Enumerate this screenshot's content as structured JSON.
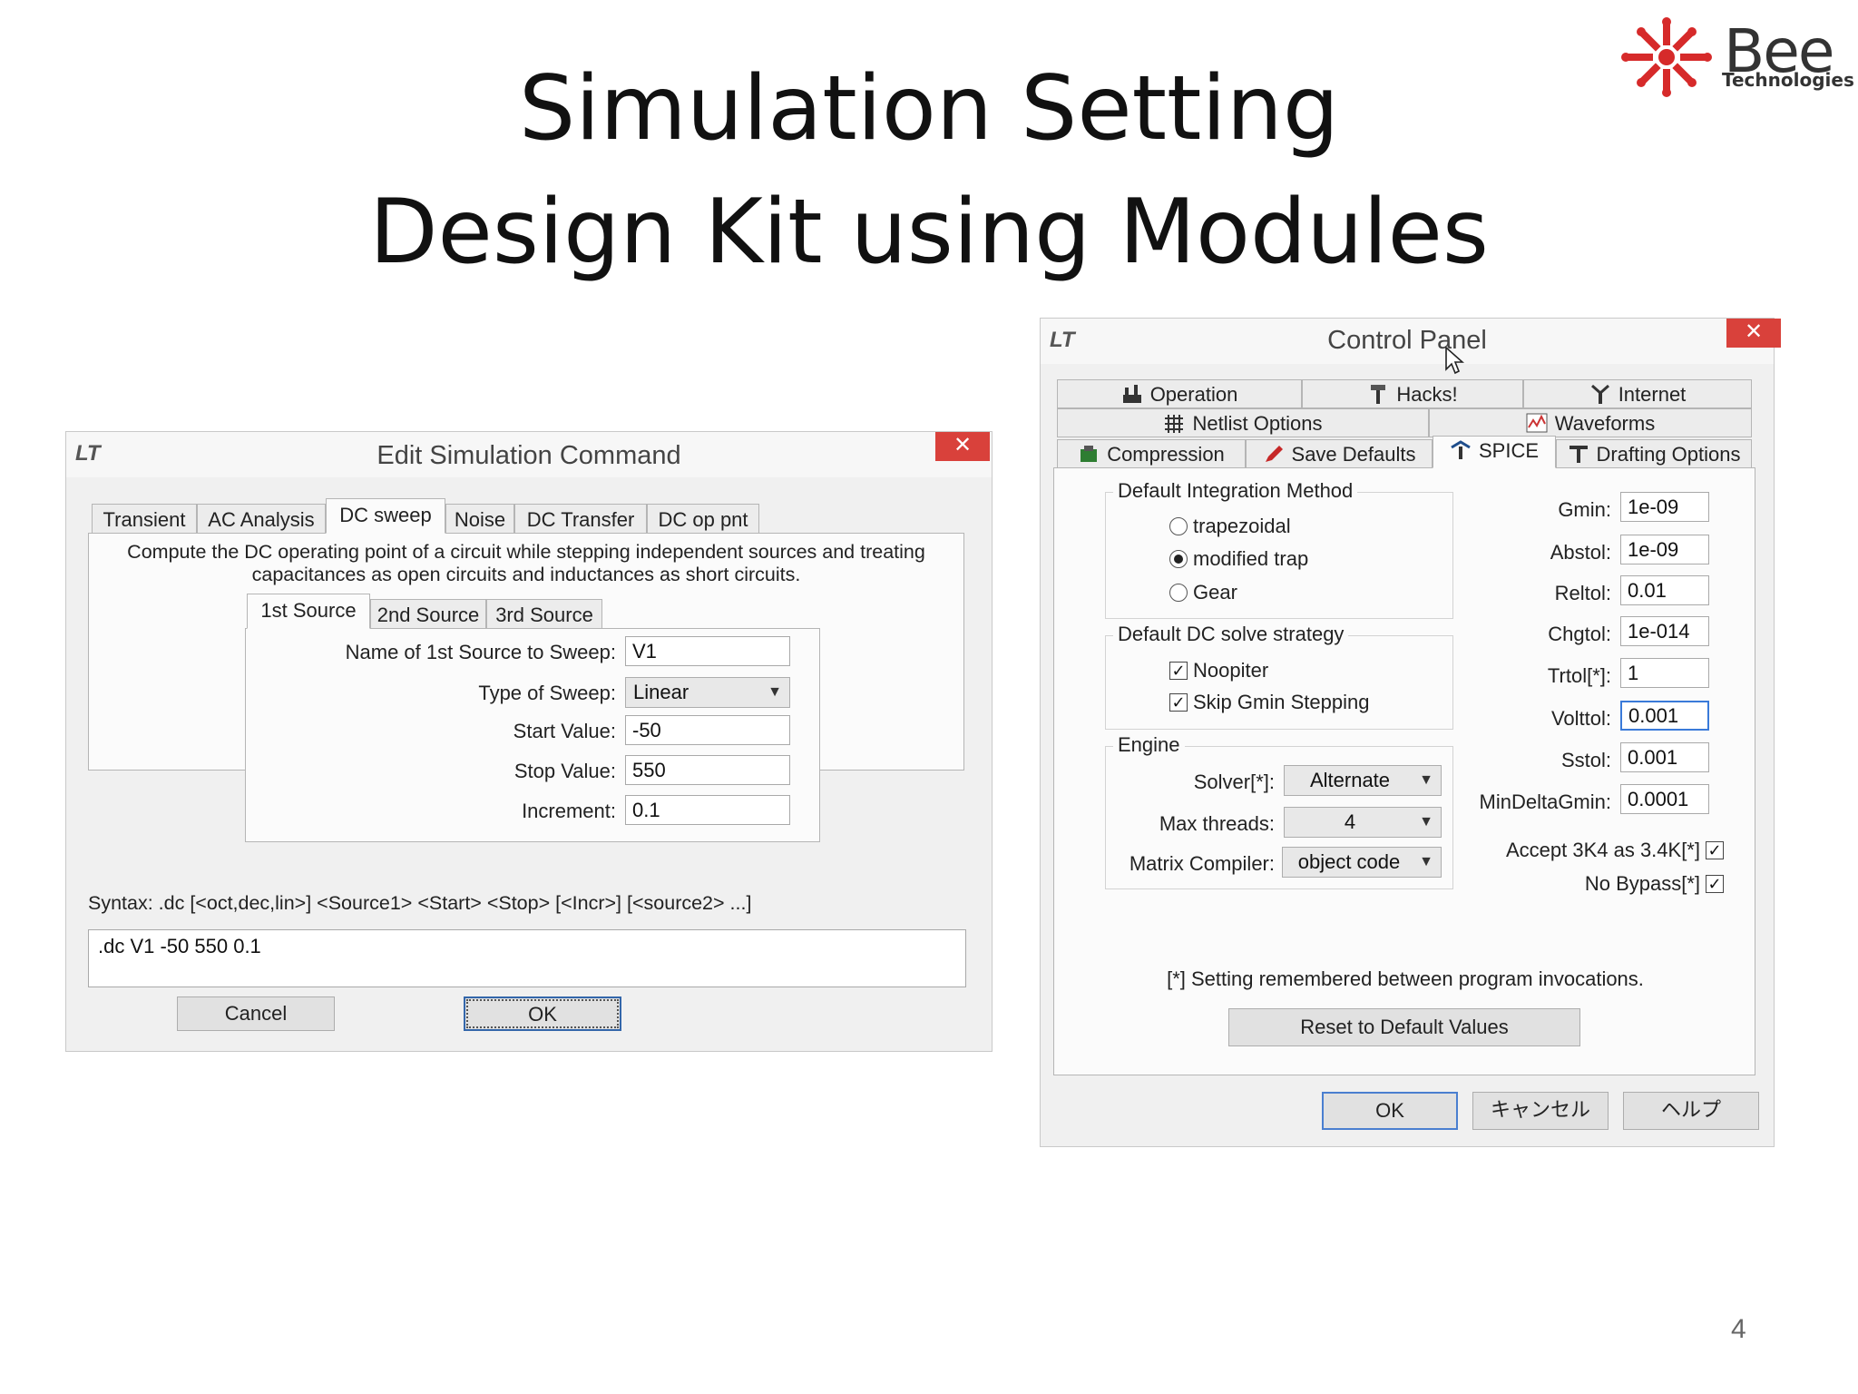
{
  "slide": {
    "title_line1": "Simulation Setting",
    "title_line2": "Design Kit using Modules",
    "logo_name": "Bee",
    "logo_sub": "Technologies",
    "page_number": "4"
  },
  "edit_dialog": {
    "title": "Edit Simulation Command",
    "close_label": "✕",
    "tabs": [
      "Transient",
      "AC Analysis",
      "DC sweep",
      "Noise",
      "DC Transfer",
      "DC op pnt"
    ],
    "active_tab": "DC sweep",
    "description": "Compute the DC operating point of a circuit while stepping independent sources and treating capacitances as open circuits and inductances as short circuits.",
    "source_tabs": [
      "1st Source",
      "2nd Source",
      "3rd Source"
    ],
    "fields": {
      "name_label": "Name of 1st Source to Sweep:",
      "name_value": "V1",
      "type_label": "Type of Sweep:",
      "type_value": "Linear",
      "start_label": "Start Value:",
      "start_value": "-50",
      "stop_label": "Stop Value:",
      "stop_value": "550",
      "increment_label": "Increment:",
      "increment_value": "0.1"
    },
    "syntax": "Syntax:  .dc [<oct,dec,lin>] <Source1> <Start> <Stop> [<Incr>] [<source2> ...]",
    "command": ".dc V1 -50 550 0.1",
    "cancel_label": "Cancel",
    "ok_label": "OK"
  },
  "control_panel": {
    "title": "Control Panel",
    "close_label": "✕",
    "tabs_row1": [
      "Operation",
      "Hacks!",
      "Internet"
    ],
    "tabs_row2": [
      "Netlist Options",
      "Waveforms"
    ],
    "tabs_row3": [
      "Compression",
      "Save Defaults",
      "SPICE",
      "Drafting Options"
    ],
    "active_tab": "SPICE",
    "integration": {
      "label": "Default Integration Method",
      "options": [
        "trapezoidal",
        "modified trap",
        "Gear"
      ],
      "selected": "modified trap"
    },
    "dc_strategy": {
      "label": "Default DC solve strategy",
      "noopiter": "Noopiter",
      "skip_gmin": "Skip Gmin Stepping"
    },
    "engine": {
      "label": "Engine",
      "solver_label": "Solver[*]:",
      "solver_value": "Alternate",
      "threads_label": "Max threads:",
      "threads_value": "4",
      "matrix_label": "Matrix Compiler:",
      "matrix_value": "object code"
    },
    "params": [
      {
        "label": "Gmin:",
        "value": "1e-09"
      },
      {
        "label": "Abstol:",
        "value": "1e-09"
      },
      {
        "label": "Reltol:",
        "value": "0.01"
      },
      {
        "label": "Chgtol:",
        "value": "1e-014"
      },
      {
        "label": "Trtol[*]:",
        "value": "1"
      },
      {
        "label": "Volttol:",
        "value": "0.001"
      },
      {
        "label": "Sstol:",
        "value": "0.001"
      },
      {
        "label": "MinDeltaGmin:",
        "value": "0.0001"
      }
    ],
    "accept_label": "Accept 3K4 as 3.4K[*]",
    "no_bypass_label": "No Bypass[*]",
    "note": "[*] Setting remembered between program invocations.",
    "reset_label": "Reset to Default Values",
    "ok_label": "OK",
    "cancel_label": "キャンセル",
    "help_label": "ヘルプ"
  }
}
